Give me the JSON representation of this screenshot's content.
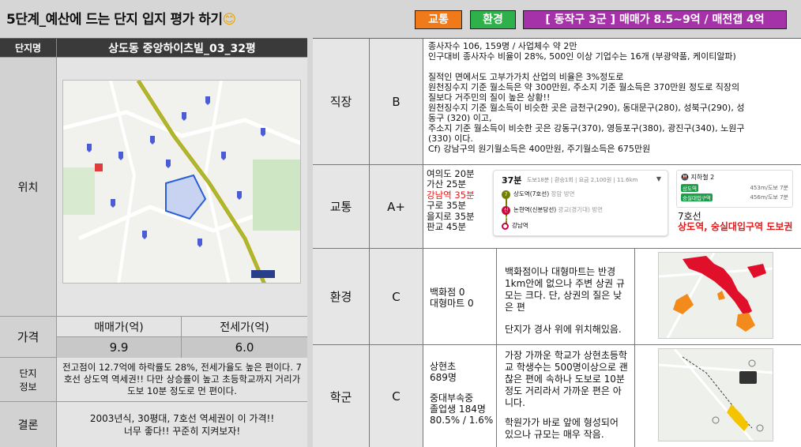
{
  "header": {
    "title": "5단계_예산에 드는 단지 입지 평가 하기",
    "emoji": "😊",
    "tags": {
      "traffic": "교통",
      "environment": "환경",
      "region": "[ 동작구 3군 ] 매매가 8.5~9억 / 매전갭 4억"
    },
    "colors": {
      "traffic": "#f07a1a",
      "environment": "#2eb14a",
      "region": "#a532a8"
    }
  },
  "left": {
    "name_label": "단지명",
    "name_value": "상도동 중앙하이츠빌_03_32평",
    "location_label": "위치",
    "price_label": "가격",
    "price_sale_header": "매매가(억)",
    "price_jeonse_header": "전세가(억)",
    "price_sale_value": "9.9",
    "price_jeonse_value": "6.0",
    "info_label": "단지\n정보",
    "info_text": "전고점이 12.7억에 하락률도 28%, 전세가율도 높은 편이다. 7호선 상도역 역세권!! 다만 상승률이 높고 초등학교까지 거리가 도보 10분 정도로 먼 편이다.",
    "conclusion_label": "결론",
    "conclusion_line1": "2003년식, 30평대, 7호선 역세권이 이 가격!!",
    "conclusion_line2": "너무 좋다!! 꾸준히 지켜보자!"
  },
  "job": {
    "label": "직장",
    "grade": "B",
    "lines": [
      "종사자수 106, 159명 / 사업체수 약 2만",
      "인구대비 종사자수 비율이 28%, 500인 이상 기업수는 16개 (부광약품, 케이티알파)",
      "",
      "질적인 면에서도 고부가가치 산업의 비율은 3%정도로",
      "원천징수지 기준 월소득은 약 300만원, 주소지 기준 월소득은 370만원 정도로 직장의",
      "질보다 거주민의 질이 높은 상황!!",
      "원천징수지 기준 월소득이 비슷한 곳은 금천구(290), 동대문구(280), 성북구(290), 성",
      "동구 (320) 이고,",
      "주소지 기준 월소득이 비슷한 곳은 강동구(370), 영등포구(380), 광진구(340), 노원구",
      "(330) 이다.",
      "Cf) 강남구의 원기월소득은 400만원, 주기월소득은 675만원"
    ]
  },
  "traffic": {
    "label": "교통",
    "grade": "A+",
    "times": [
      "여의도 20분",
      "가산 25분",
      "강남역 35분",
      "구로 35분",
      "을지로 35분",
      "판교 45분"
    ],
    "route": {
      "duration": "37분",
      "meta": "도보18분 | 환승1회 | 요금 2,100원 | 11.6km",
      "stop1": "상도역(7호선)",
      "stop1_note": "장암 방면",
      "stop2": "논현역(신분당선)",
      "stop2_note": "광교(경기대) 방면",
      "stop3": "강남역",
      "line7_badge": "7",
      "sb_badge": "신분"
    },
    "exit_box": {
      "header": "지하철 2",
      "row1_name": "상도역",
      "row1_dist": "453m/도보 7분",
      "row2_name": "숭실대입구역",
      "row2_dist": "456m/도보 7분"
    },
    "station_line": "7호선",
    "station_names": "상도역, 숭실대입구역 도보권"
  },
  "environment": {
    "label": "환경",
    "grade": "C",
    "stats_line1": "백화점 0",
    "stats_line2": "대형마트 0",
    "desc1": "백화점이나 대형마트는 반경 1km안에 없으나 주변 상권 규모는 크다. 단, 상권의 질은 낮은 편",
    "desc2": "단지가 경사 위에 위치해있음."
  },
  "school": {
    "label": "학군",
    "grade": "C",
    "stats": [
      "상현초",
      "689명",
      "",
      "중대부속중",
      "졸업생 184명",
      "80.5% / 1.6%"
    ],
    "desc1": "가장 가까운 학교가 상현초등학교 학생수는 500명이상으로 괜찮은 편에 속하나 도보로 10분 정도 거리라서 가까운 편은 아니다.",
    "desc2": "학원가가 바로 앞에 형성되어 있으나 규모는 매우 작음."
  },
  "icons": [
    "map-thumbnail",
    "route-card",
    "subway-icon",
    "commercial-map",
    "school-map"
  ]
}
